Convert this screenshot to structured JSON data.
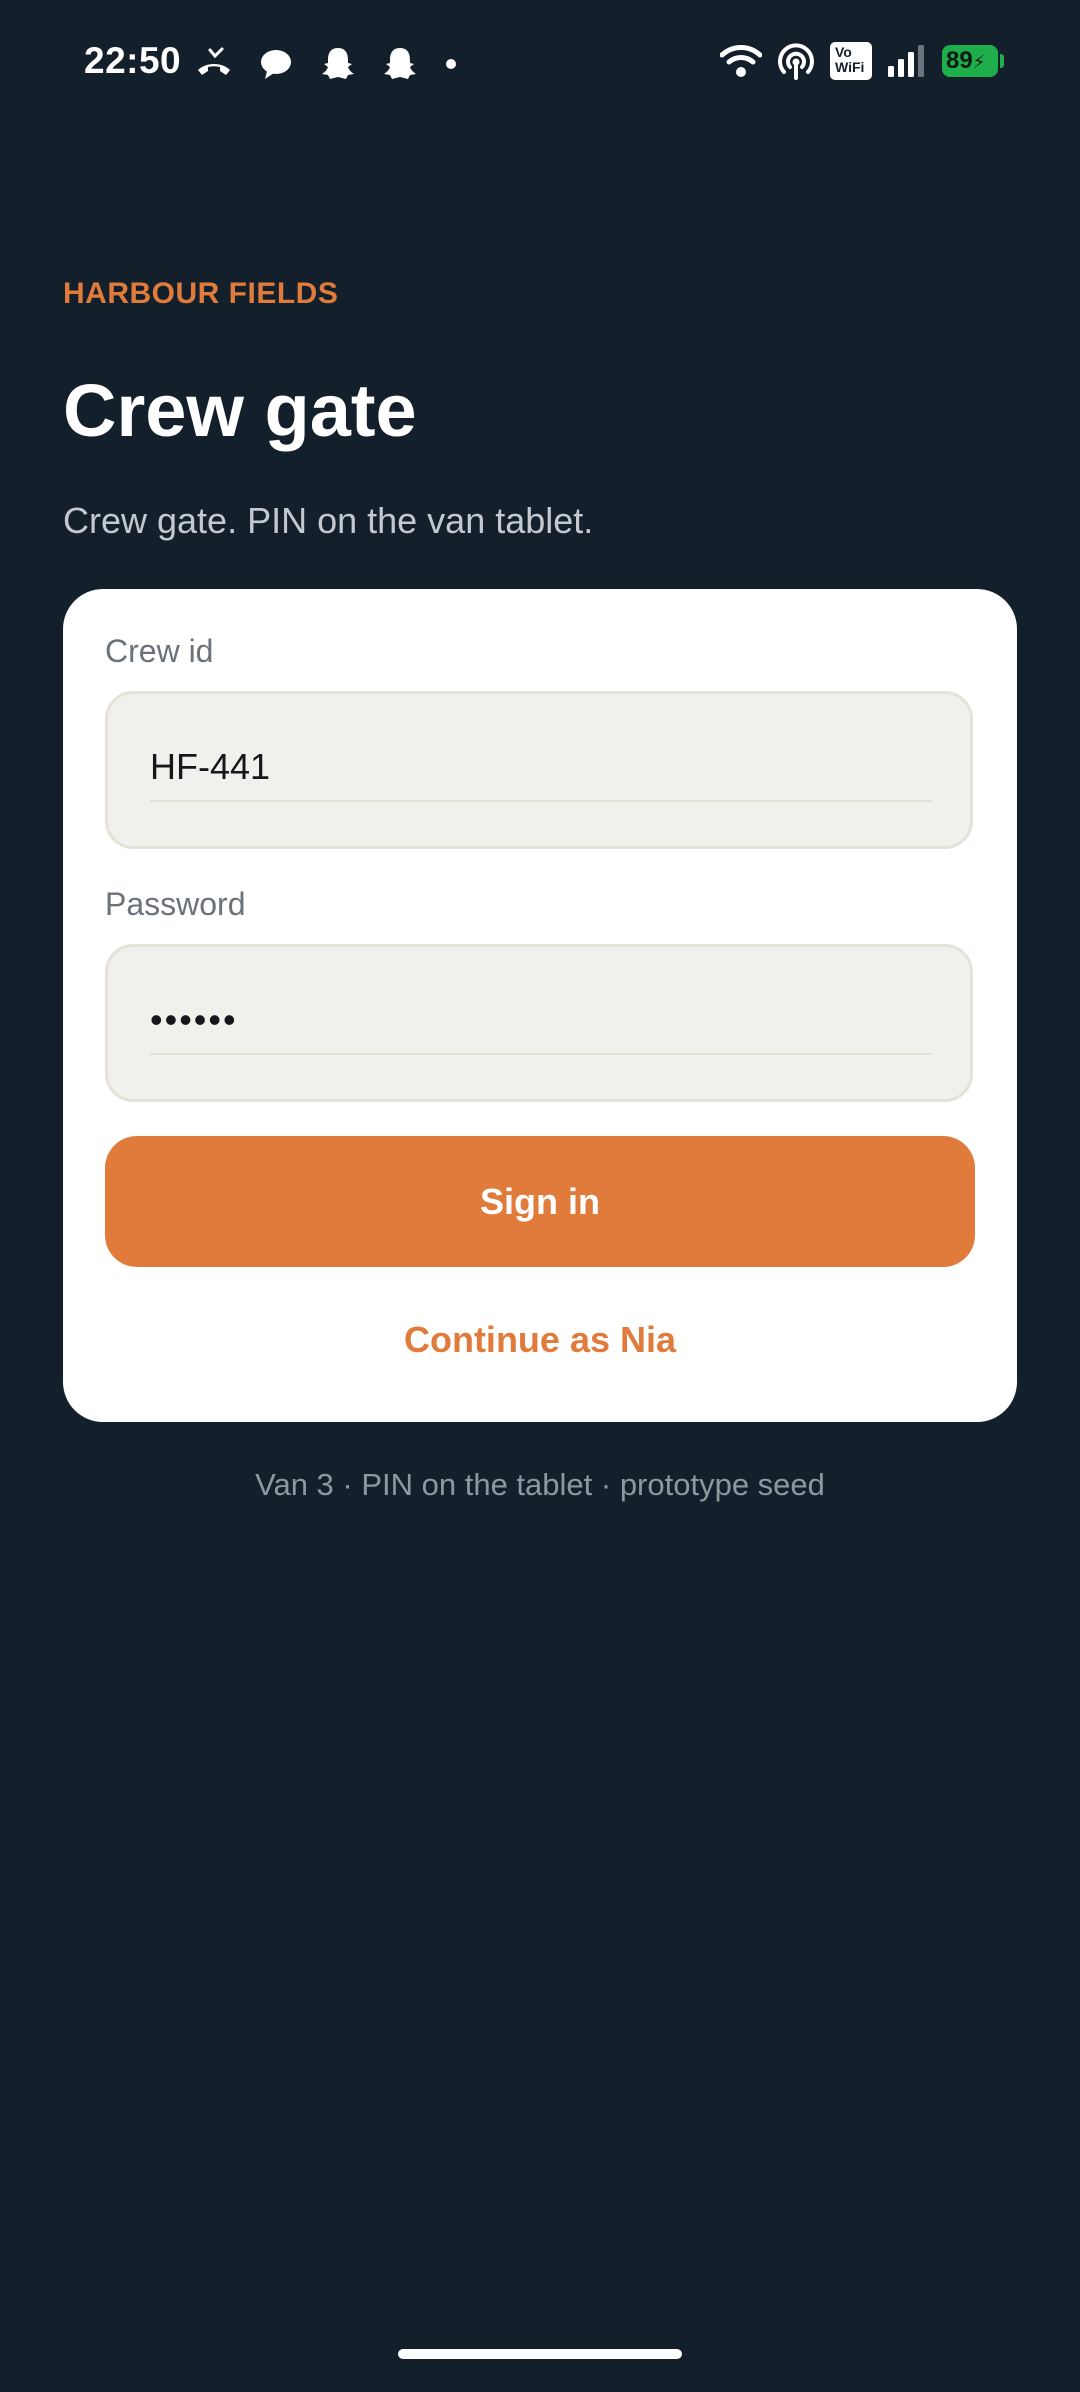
{
  "status_bar": {
    "time": "22:50",
    "vowifi_label": "Vo\nWiFi",
    "battery_level": "89",
    "icons_left": [
      "missed-call-icon",
      "chat-bubble-icon",
      "snapchat-icon",
      "snapchat-icon",
      "notification-dot"
    ],
    "icons_right": [
      "wifi-icon",
      "hotspot-icon",
      "vowifi-icon",
      "signal-icon",
      "battery-icon"
    ]
  },
  "header": {
    "brand": "HARBOUR FIELDS",
    "title": "Crew gate",
    "subtitle": "Crew gate. PIN on the van tablet."
  },
  "form": {
    "crew_id_label": "Crew id",
    "crew_id_value": "HF-441",
    "password_label": "Password",
    "password_value": "••••••",
    "submit_label": "Sign in",
    "alt_action_label": "Continue as Nia"
  },
  "footer": {
    "note": "Van 3 · PIN on the tablet · prototype seed"
  },
  "colors": {
    "background": "#13202b",
    "accent": "#e07b3c",
    "card": "#ffffff",
    "field_bg": "#f1f0ec",
    "battery": "#1fae4c"
  }
}
